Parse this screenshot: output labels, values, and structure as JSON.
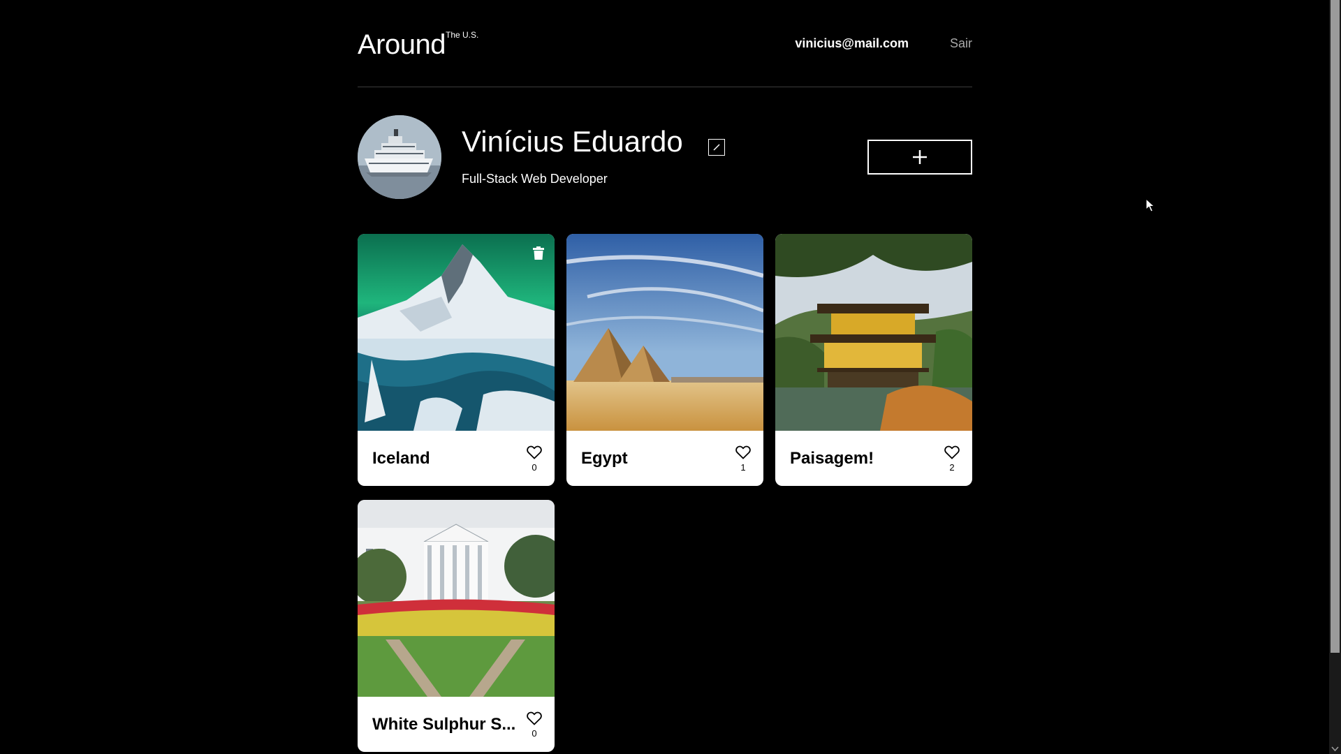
{
  "header": {
    "logo": "Around",
    "logo_sup": "The U.S.",
    "user_email": "vinicius@mail.com",
    "logout_label": "Sair"
  },
  "profile": {
    "name": "Vinícius Eduardo",
    "about": "Full-Stack Web Developer"
  },
  "cards": [
    {
      "title": "Iceland",
      "likes": "0",
      "deletable": true,
      "image": "iceland-mountain-aurora"
    },
    {
      "title": "Egypt",
      "likes": "1",
      "deletable": false,
      "image": "egypt-pyramids"
    },
    {
      "title": "Paisagem!",
      "likes": "2",
      "deletable": false,
      "image": "japanese-golden-pavilion"
    },
    {
      "title": "White Sulphur S...",
      "likes": "0",
      "deletable": false,
      "image": "white-sulphur-springs-hotel"
    }
  ],
  "icons": {
    "edit": "pencil-icon",
    "add": "plus-icon",
    "like": "heart-outline-icon",
    "delete": "trash-icon"
  },
  "colors": {
    "background": "#000000",
    "card_background": "#ffffff",
    "logout": "#a9a9a9"
  }
}
